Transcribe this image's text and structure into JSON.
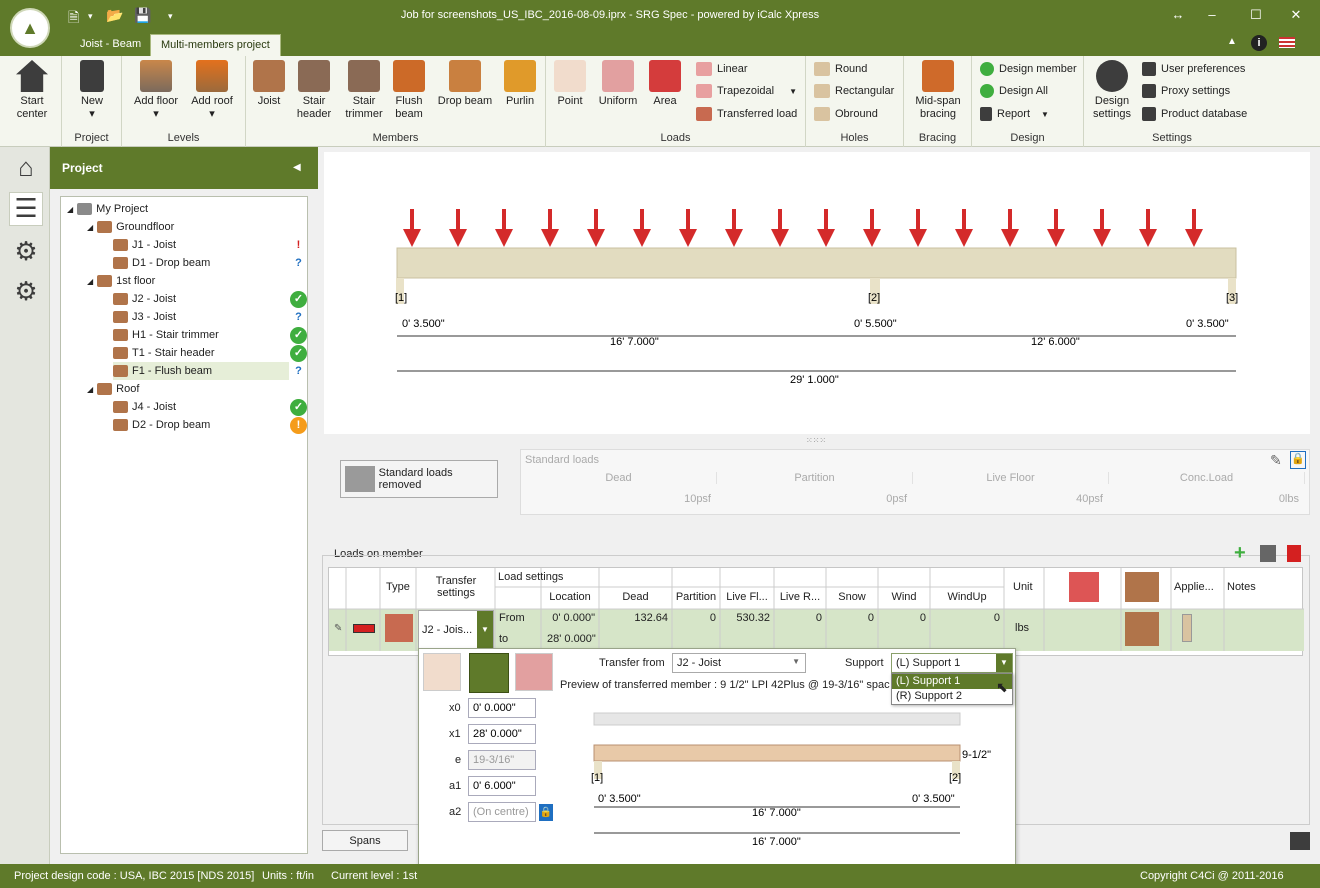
{
  "app": {
    "title": "Job for screenshots_US_IBC_2016-08-09.iprx - SRG Spec - powered by iCalc Xpress"
  },
  "tabs": [
    "Joist - Beam",
    "Multi-members project"
  ],
  "ribbon": {
    "start_center": "Start center",
    "new": "New",
    "group_project": "Project",
    "add_floor": "Add floor",
    "add_roof": "Add roof",
    "group_levels": "Levels",
    "joist": "Joist",
    "stair_header": "Stair header",
    "stair_trimmer": "Stair trimmer",
    "flush_beam": "Flush beam",
    "drop_beam": "Drop beam",
    "purlin": "Purlin",
    "group_members": "Members",
    "point": "Point",
    "uniform": "Uniform",
    "area": "Area",
    "linear": "Linear",
    "trapezoidal": "Trapezoidal",
    "transferred": "Transferred load",
    "group_loads": "Loads",
    "round": "Round",
    "rectangular": "Rectangular",
    "obround": "Obround",
    "group_holes": "Holes",
    "midspan": "Mid-span bracing",
    "group_bracing": "Bracing",
    "design_member": "Design member",
    "design_all": "Design All",
    "report": "Report",
    "group_design": "Design",
    "design_settings": "Design settings",
    "user_prefs": "User preferences",
    "proxy": "Proxy settings",
    "product_db": "Product database",
    "group_settings": "Settings"
  },
  "project": {
    "header": "Project",
    "root": "My Project",
    "nodes": [
      {
        "label": "Groundfloor",
        "level": 1
      },
      {
        "label": "J1 - Joist",
        "level": 2,
        "status": "!"
      },
      {
        "label": "D1 - Drop beam",
        "level": 2,
        "status": "?"
      },
      {
        "label": "1st floor",
        "level": 1
      },
      {
        "label": "J2 - Joist",
        "level": 2,
        "status": "ok"
      },
      {
        "label": "J3 - Joist",
        "level": 2,
        "status": "?"
      },
      {
        "label": "H1 - Stair trimmer",
        "level": 2,
        "status": "ok"
      },
      {
        "label": "T1 - Stair header",
        "level": 2,
        "status": "ok"
      },
      {
        "label": "F1 - Flush beam",
        "level": 2,
        "status": "?"
      },
      {
        "label": "Roof",
        "level": 1
      },
      {
        "label": "J4 - Joist",
        "level": 2,
        "status": "ok"
      },
      {
        "label": "D2 - Drop beam",
        "level": 2,
        "status": "warn"
      }
    ]
  },
  "beam": {
    "supports": [
      "[1]",
      "[2]",
      "[3]"
    ],
    "d1": "0' 3.500\"",
    "d2": "0' 5.500\"",
    "d3": "0' 3.500\"",
    "span1": "16' 7.000\"",
    "span2": "12' 6.000\"",
    "total": "29' 1.000\""
  },
  "std": {
    "button": "Standard loads removed",
    "title": "Standard loads",
    "cols": [
      "Dead",
      "Partition",
      "Live Floor",
      "Conc.Load"
    ],
    "vals": [
      "10psf",
      "0psf",
      "40psf",
      "0lbs"
    ]
  },
  "grid": {
    "title": "Loads on member",
    "hdr_type": "Type",
    "hdr_transfer": "Transfer settings",
    "hdr_load": "Load settings",
    "cols": [
      "Location",
      "Dead",
      "Partition",
      "Live Fl...",
      "Live R...",
      "Snow",
      "Wind",
      "WindUp"
    ],
    "hdr_unit": "Unit",
    "hdr_applied": "Applie...",
    "hdr_notes": "Notes",
    "transfer_val": "J2 - Jois...",
    "from": "From",
    "to": "to",
    "row_from": [
      "0' 0.000\"",
      "132.64",
      "0",
      "530.32",
      "0",
      "0",
      "0",
      "0"
    ],
    "row_to": "28' 0.000\"",
    "unit": "lbs"
  },
  "popup": {
    "transfer_from_label": "Transfer from",
    "transfer_from": "J2 - Joist",
    "support_label": "Support",
    "support": "(L) Support 1",
    "options": [
      "(L) Support 1",
      "(R) Support 2"
    ],
    "preview": "Preview of transferred member : 9 1/2\" LPI 42Plus @ 19-3/16\" spacin",
    "x0_label": "x0",
    "x0": "0' 0.000\"",
    "x1_label": "x1",
    "x1": "28' 0.000\"",
    "e_label": "e",
    "e": "19-3/16\"",
    "a1_label": "a1",
    "a1": "0' 6.000\"",
    "a2_label": "a2",
    "a2": "(On centre)",
    "depth": "9-1/2\"",
    "s1": "[1]",
    "s2": "[2]",
    "pd1": "0' 3.500\"",
    "pd2": "0' 3.500\"",
    "pspan": "16' 7.000\"",
    "ptotal": "16' 7.000\""
  },
  "spans": "Spans",
  "status": {
    "code": "Project design code : USA, IBC 2015 [NDS 2015]",
    "units": "Units : ft/in",
    "level": "Current level : 1st",
    "copyright": "Copyright C4Ci @ 2011-2016"
  },
  "colors": {
    "brand": "#5f7a2a",
    "load_arrow": "#d42a2a",
    "beam": "#e2dcc0",
    "ok": "#3fae3f",
    "warn": "#f59c1a",
    "err": "#d42020",
    "info": "#1f6fc1"
  }
}
